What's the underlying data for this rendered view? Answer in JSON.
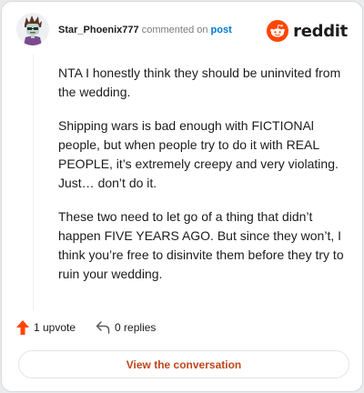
{
  "comment": {
    "username": "Star_Phoenix777",
    "commented_on": "commented on",
    "post_link": "post",
    "paragraphs": [
      "NTA I honestly think they should be uninvited from the wedding.",
      "Shipping wars is bad enough with FICTIONAl people, but when people try to do it with REAL PEOPLE, it’s extremely creepy and very violating. Just… don’t do it.",
      "These two need to let go of a thing that didn’t happen FIVE YEARS AGO. But since they won’t, I think you’re free to disinvite them before they try to ruin your wedding."
    ]
  },
  "brand": {
    "logo_text": "reddit",
    "logo_icon": "reddit-snoo-icon",
    "accent": "#ff4500"
  },
  "actions": {
    "upvotes": "1 upvote",
    "replies": "0 replies",
    "upvote_icon": "upvote-arrow-icon",
    "reply_icon": "reply-icon",
    "upvote_color": "#ff4500"
  },
  "cta": {
    "label": "View the conversation",
    "color": "#c0461b"
  },
  "avatar": {
    "icon": "avatar-icon"
  }
}
